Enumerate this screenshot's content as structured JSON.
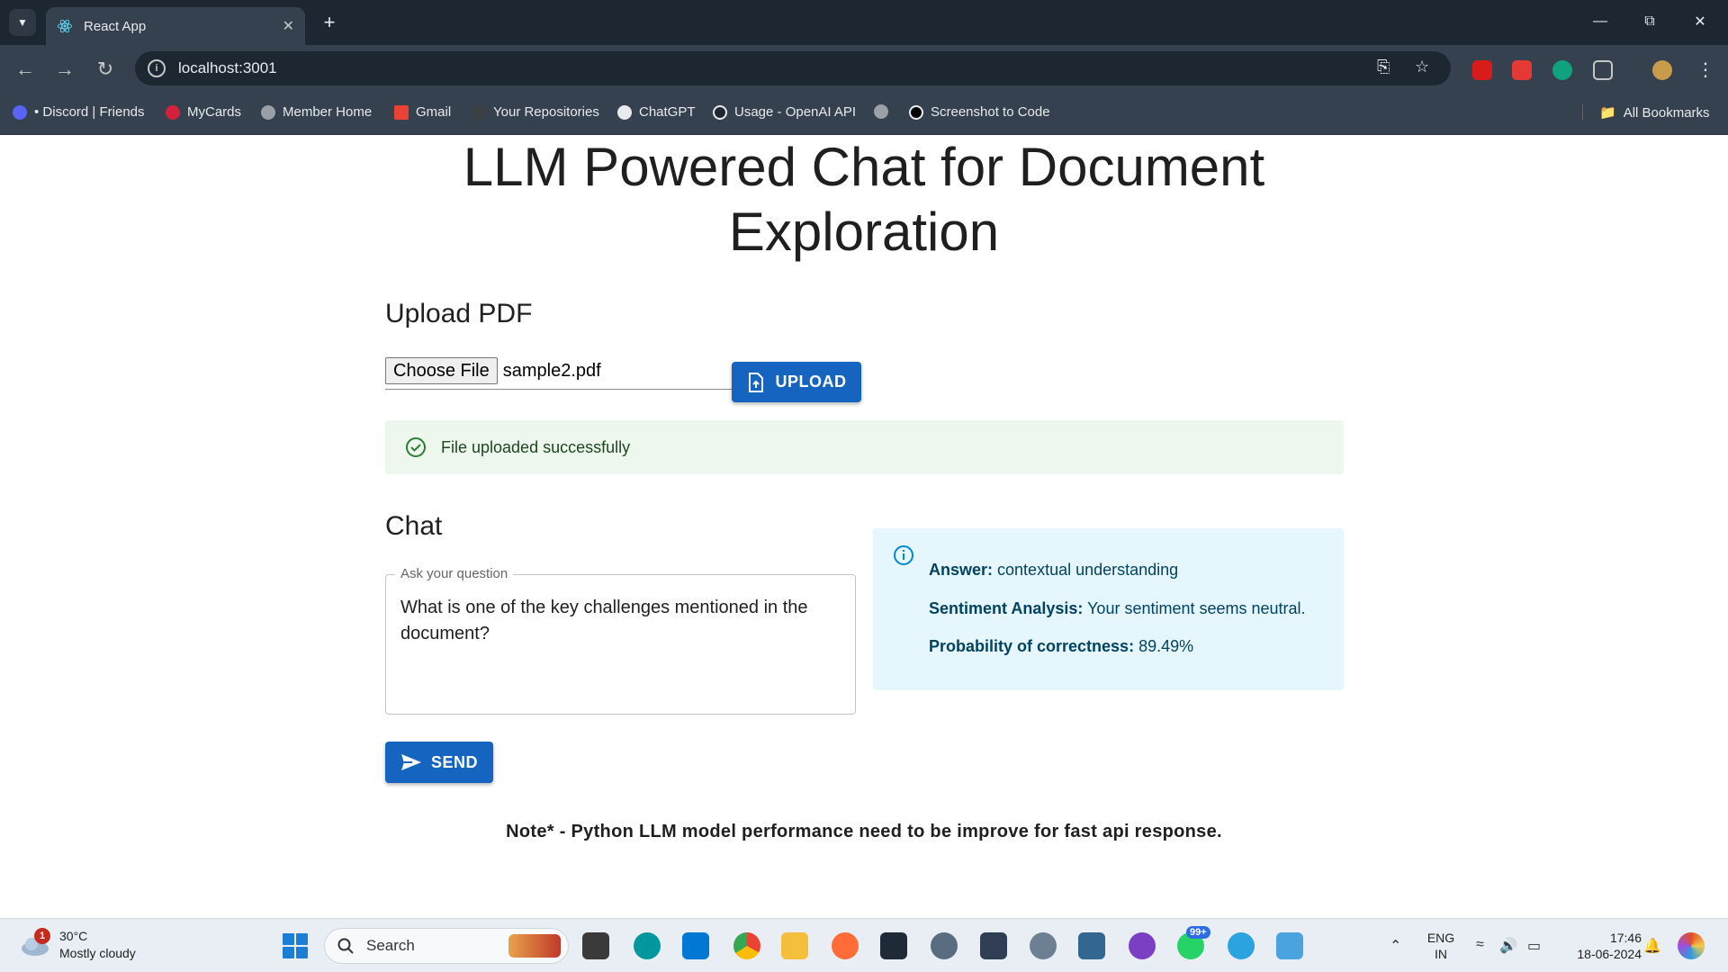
{
  "browser": {
    "tab_title": "React App",
    "url": "localhost:3001",
    "bookmarks": [
      {
        "label": "• Discord | Friends",
        "color": "#5865f2"
      },
      {
        "label": "MyCards",
        "color": "#d4213d"
      },
      {
        "label": "Member Home",
        "color": "#9aa0a6"
      },
      {
        "label": "Gmail",
        "color": "#ea4335"
      },
      {
        "label": "Your Repositories",
        "color": "#3c4043"
      },
      {
        "label": "ChatGPT",
        "color": "#e8eaed"
      },
      {
        "label": "Usage - OpenAI API",
        "color": "#1d2732"
      },
      {
        "label": "",
        "color": "#9aa0a6"
      },
      {
        "label": "Screenshot to Code",
        "color": "#000000"
      }
    ],
    "all_bookmarks": "All Bookmarks"
  },
  "page": {
    "title": "LLM Powered Chat for Document Exploration",
    "upload_heading": "Upload PDF",
    "choose_file_label": "Choose File",
    "file_name": "sample2.pdf",
    "upload_button": "UPLOAD",
    "success_message": "File uploaded successfully",
    "chat_heading": "Chat",
    "question_label": "Ask your question",
    "question_value": "What is one of the key challenges mentioned in the document?",
    "send_button": "SEND",
    "answer": {
      "answer_label": "Answer:",
      "answer_value": "contextual understanding",
      "sentiment_label": "Sentiment Analysis:",
      "sentiment_value": "Your sentiment seems neutral.",
      "probability_label": "Probability of correctness:",
      "probability_value": "89.49%"
    },
    "note": "Note* - Python LLM model performance need to be improve for fast api response."
  },
  "taskbar": {
    "weather_temp": "30°C",
    "weather_desc": "Mostly cloudy",
    "weather_badge": "1",
    "search_placeholder": "Search",
    "whatsapp_badge": "99+",
    "lang_top": "ENG",
    "lang_bottom": "IN",
    "time": "17:46",
    "date": "18-06-2024"
  },
  "colors": {
    "primary": "#1565c0",
    "success_bg": "#edf7ed",
    "info_bg": "#e5f6fd",
    "chrome_dark": "#1d2732",
    "chrome_mid": "#35414e"
  }
}
